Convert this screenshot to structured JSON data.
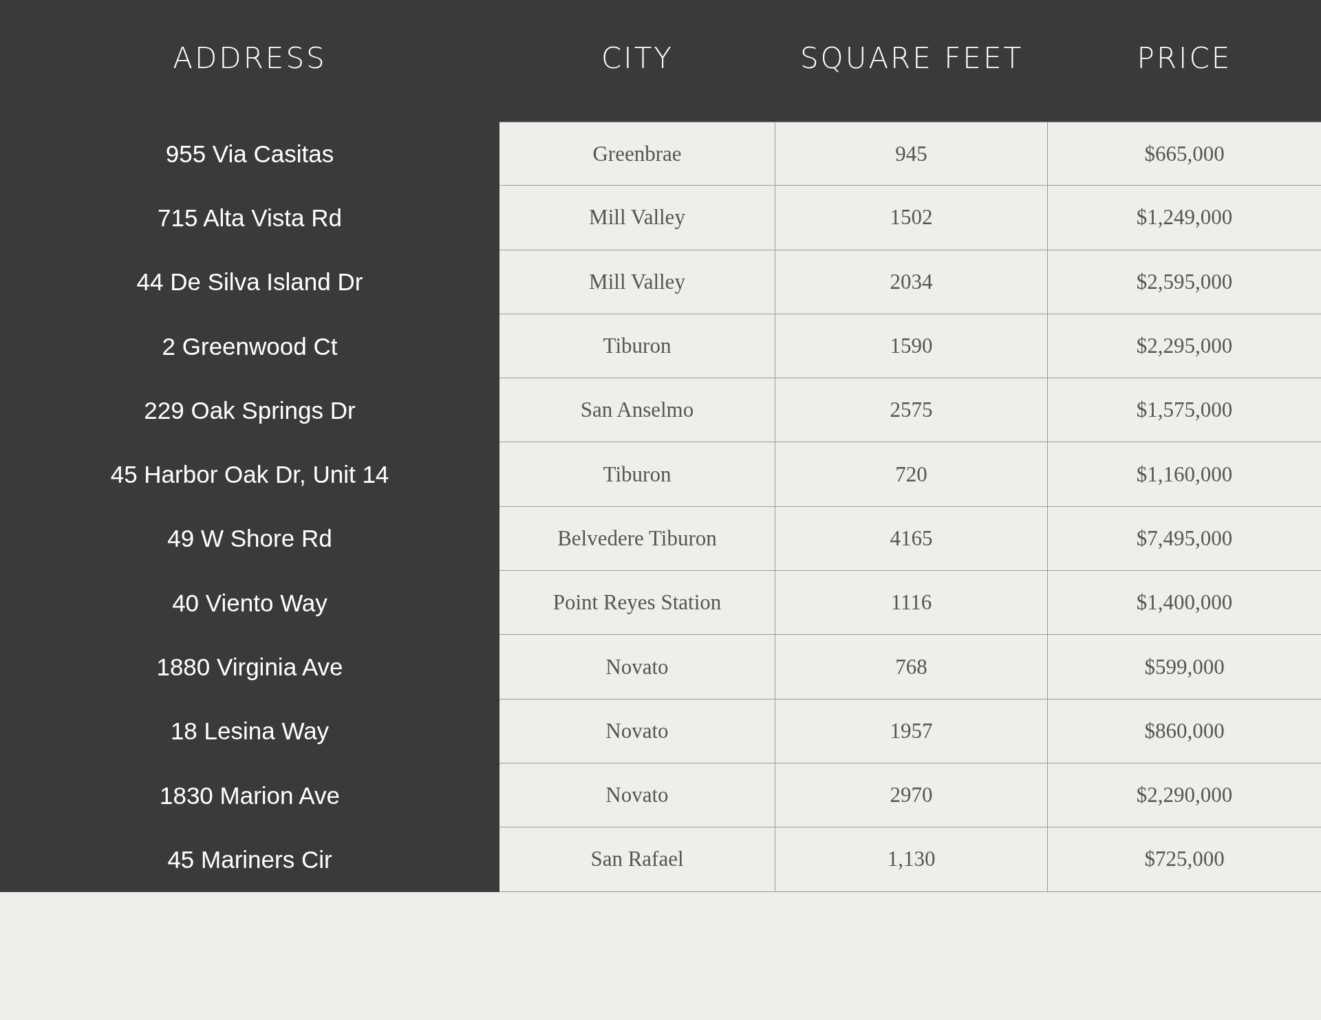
{
  "table": {
    "columns": [
      "ADDRESS",
      "CITY",
      "SQUARE FEET",
      "PRICE"
    ],
    "rows": [
      [
        "955 Via Casitas",
        "Greenbrae",
        "945",
        "$665,000"
      ],
      [
        "715 Alta Vista Rd",
        "Mill Valley",
        "1502",
        "$1,249,000"
      ],
      [
        "44 De Silva Island Dr",
        "Mill Valley",
        "2034",
        "$2,595,000"
      ],
      [
        "2 Greenwood Ct",
        "Tiburon",
        "1590",
        "$2,295,000"
      ],
      [
        "229 Oak Springs Dr",
        "San Anselmo",
        "2575",
        "$1,575,000"
      ],
      [
        "45 Harbor Oak Dr, Unit 14",
        "Tiburon",
        "720",
        "$1,160,000"
      ],
      [
        "49 W Shore Rd",
        "Belvedere Tiburon",
        "4165",
        "$7,495,000"
      ],
      [
        "40 Viento Way",
        "Point Reyes Station",
        "1116",
        "$1,400,000"
      ],
      [
        "1880 Virginia Ave",
        "Novato",
        "768",
        "$599,000"
      ],
      [
        "18 Lesina Way",
        "Novato",
        "1957",
        "$860,000"
      ],
      [
        "1830 Marion Ave",
        "Novato",
        "2970",
        "$2,290,000"
      ],
      [
        "45 Mariners Cir",
        "San Rafael",
        "1,130",
        "$725,000"
      ]
    ]
  }
}
